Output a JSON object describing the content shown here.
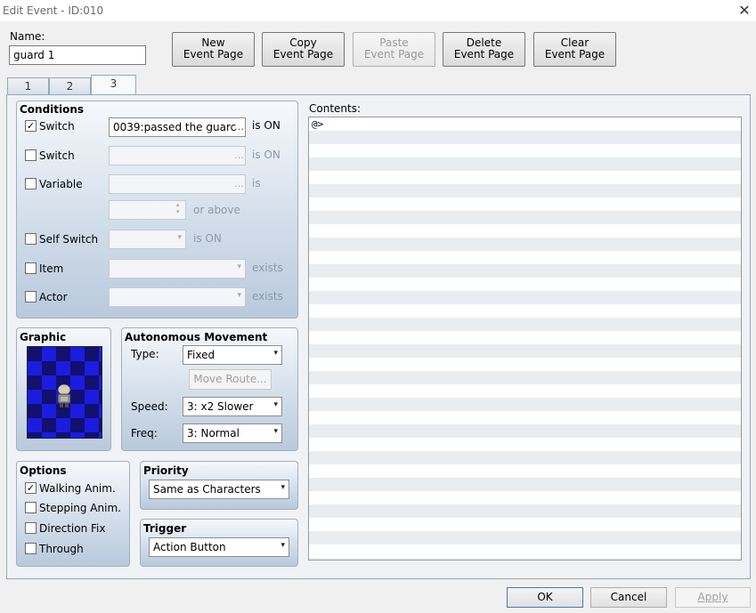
{
  "window": {
    "title": "Edit Event - ID:010",
    "close_glyph": "✕"
  },
  "name": {
    "label": "Name:",
    "value": "guard 1"
  },
  "buttons": {
    "new": [
      "New",
      "Event Page"
    ],
    "copy": [
      "Copy",
      "Event Page"
    ],
    "paste": [
      "Paste",
      "Event Page"
    ],
    "delete": [
      "Delete",
      "Event Page"
    ],
    "clear": [
      "Clear",
      "Event Page"
    ]
  },
  "tabs": [
    "1",
    "2",
    "3"
  ],
  "conditions": {
    "title": "Conditions",
    "switch1": {
      "label": "Switch",
      "checked": true,
      "value": "0039:passed the guarc",
      "suffix": "is ON"
    },
    "switch2": {
      "label": "Switch",
      "checked": false,
      "value": "",
      "suffix": "is ON"
    },
    "variable": {
      "label": "Variable",
      "checked": false,
      "value": "",
      "suffix": "is",
      "suffix2": "or above"
    },
    "self_switch": {
      "label": "Self Switch",
      "checked": false,
      "suffix": "is ON"
    },
    "item": {
      "label": "Item",
      "checked": false,
      "suffix": "exists"
    },
    "actor": {
      "label": "Actor",
      "checked": false,
      "suffix": "exists"
    }
  },
  "graphic": {
    "title": "Graphic"
  },
  "movement": {
    "title": "Autonomous Movement",
    "type_label": "Type:",
    "type_value": "Fixed",
    "move_route": "Move Route...",
    "speed_label": "Speed:",
    "speed_value": "3: x2 Slower",
    "freq_label": "Freq:",
    "freq_value": "3: Normal"
  },
  "options": {
    "title": "Options",
    "walking": {
      "label": "Walking Anim.",
      "checked": true
    },
    "stepping": {
      "label": "Stepping Anim.",
      "checked": false
    },
    "direction_fix": {
      "label": "Direction Fix",
      "checked": false
    },
    "through": {
      "label": "Through",
      "checked": false
    }
  },
  "priority": {
    "title": "Priority",
    "value": "Same as Characters"
  },
  "trigger": {
    "title": "Trigger",
    "value": "Action Button"
  },
  "contents": {
    "label": "Contents:",
    "lines": [
      "@>"
    ]
  },
  "footer": {
    "ok": "OK",
    "cancel": "Cancel",
    "apply": "Apply"
  },
  "icons": {
    "check": "✓",
    "dropdown": "▾",
    "ellipsis": "…",
    "spin_up": "▴",
    "spin_down": "▾"
  }
}
